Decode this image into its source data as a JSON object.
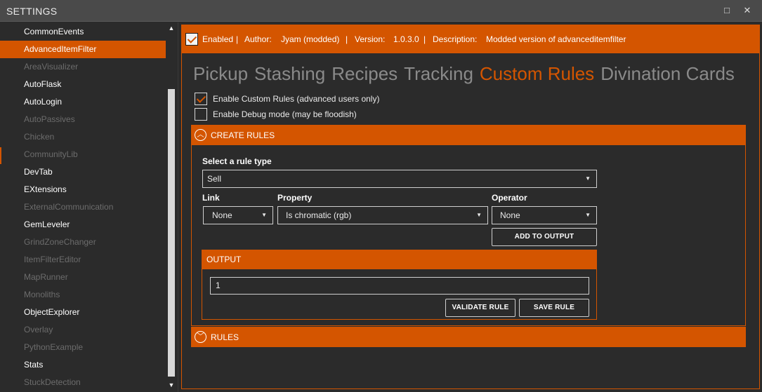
{
  "window": {
    "title": "SETTINGS",
    "maximize_glyph": "□",
    "close_glyph": "✕"
  },
  "sidebar": {
    "items": [
      {
        "label": "CommonEvents",
        "state": "enabled"
      },
      {
        "label": "AdvancedItemFilter",
        "state": "selected"
      },
      {
        "label": "AreaVisualizer",
        "state": "disabled"
      },
      {
        "label": "AutoFlask",
        "state": "enabled"
      },
      {
        "label": "AutoLogin",
        "state": "enabled"
      },
      {
        "label": "AutoPassives",
        "state": "disabled"
      },
      {
        "label": "Chicken",
        "state": "disabled"
      },
      {
        "label": "CommunityLib",
        "state": "disabled"
      },
      {
        "label": "DevTab",
        "state": "enabled"
      },
      {
        "label": "EXtensions",
        "state": "enabled"
      },
      {
        "label": "ExternalCommunication",
        "state": "disabled"
      },
      {
        "label": "GemLeveler",
        "state": "enabled"
      },
      {
        "label": "GrindZoneChanger",
        "state": "disabled"
      },
      {
        "label": "ItemFilterEditor",
        "state": "disabled"
      },
      {
        "label": "MapRunner",
        "state": "disabled"
      },
      {
        "label": "Monoliths",
        "state": "disabled"
      },
      {
        "label": "ObjectExplorer",
        "state": "enabled"
      },
      {
        "label": "Overlay",
        "state": "disabled"
      },
      {
        "label": "PythonExample",
        "state": "disabled"
      },
      {
        "label": "Stats",
        "state": "enabled"
      },
      {
        "label": "StuckDetection",
        "state": "disabled"
      }
    ],
    "scroll_up_glyph": "▲",
    "scroll_down_glyph": "▼"
  },
  "plugin_info": {
    "enabled_label": "Enabled",
    "sep": "|",
    "author_label": "Author:",
    "author": "Jyam (modded)",
    "version_label": "Version:",
    "version": "1.0.3.0",
    "description_label": "Description:",
    "description": "Modded version of advanceditemfilter"
  },
  "tabs": [
    "Pickup",
    "Stashing",
    "Recipes",
    "Tracking",
    "Custom Rules",
    "Divination Cards"
  ],
  "active_tab": "Custom Rules",
  "options": {
    "custom_rules": {
      "label": "Enable Custom Rules (advanced users only)",
      "checked": true
    },
    "debug_mode": {
      "label": "Enable Debug mode (may be floodish)",
      "checked": false
    }
  },
  "create_rules": {
    "header": "CREATE RULES",
    "toggle_glyph": "︿",
    "rule_type_label": "Select a rule type",
    "rule_type_value": "Sell",
    "link_label": "Link",
    "link_value": "None",
    "property_label": "Property",
    "property_value": "Is chromatic (rgb)",
    "operator_label": "Operator",
    "operator_value": "None",
    "add_button": "ADD TO OUTPUT",
    "dropdown_glyph": "▼"
  },
  "output": {
    "header": "OUTPUT",
    "value": "1",
    "validate_button": "VALIDATE RULE",
    "save_button": "SAVE RULE"
  },
  "rules": {
    "header": "RULES",
    "toggle_glyph": "﹀"
  },
  "colors": {
    "accent": "#d45500",
    "background": "#2b2b2b",
    "titlebar": "#4a4a4a"
  }
}
